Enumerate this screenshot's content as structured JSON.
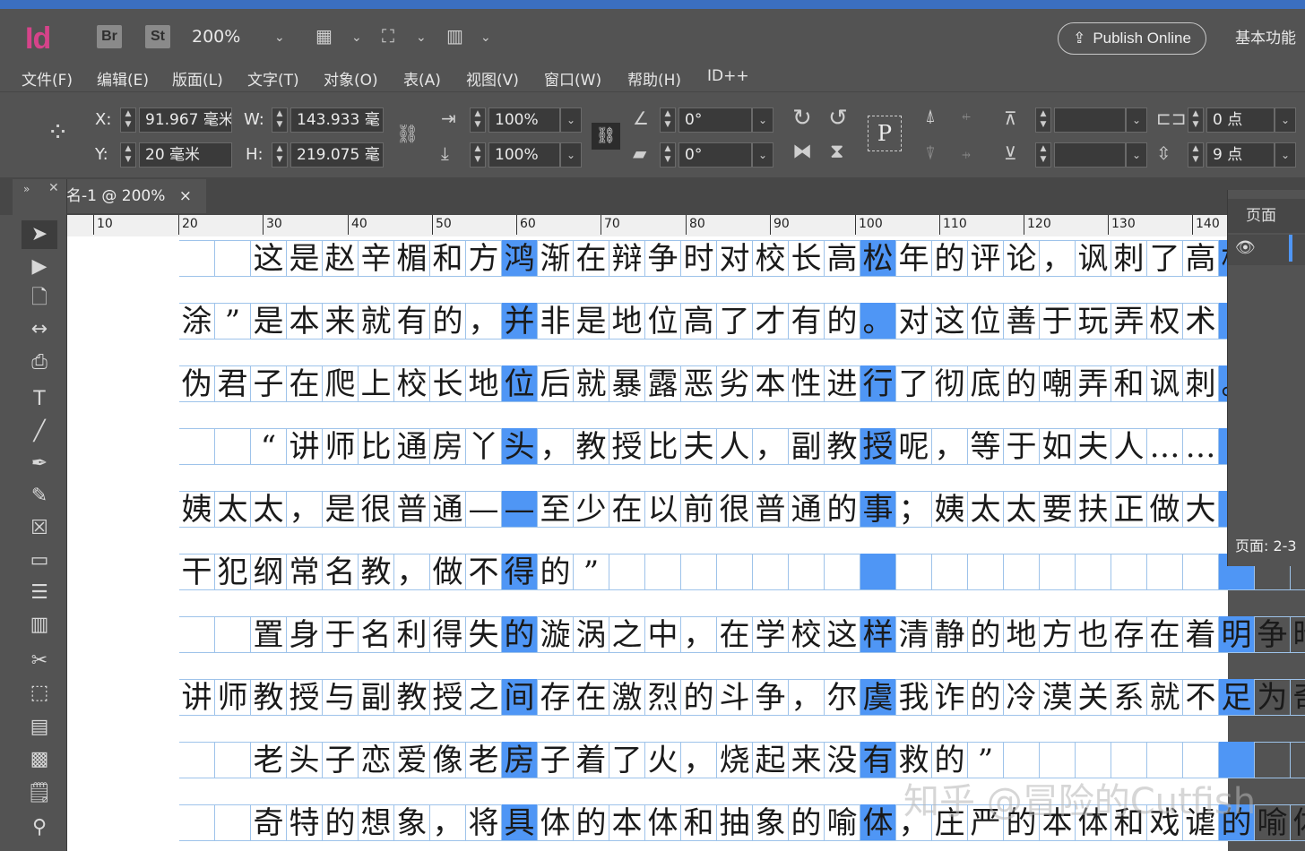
{
  "app": {
    "logo": "Id",
    "bridge_label": "Br",
    "stock_label": "St",
    "zoom": "200%",
    "publish_label": "Publish Online",
    "workspace": "基本功能"
  },
  "menu": [
    "文件(F)",
    "编辑(E)",
    "版面(L)",
    "文字(T)",
    "对象(O)",
    "表(A)",
    "视图(V)",
    "窗口(W)",
    "帮助(H)",
    "ID++"
  ],
  "control": {
    "x_label": "X:",
    "x_value": "91.967 毫米",
    "y_label": "Y:",
    "y_value": "20 毫米",
    "w_label": "W:",
    "w_value": "143.933 毫",
    "h_label": "H:",
    "h_value": "219.075 毫",
    "scale_x": "100%",
    "scale_y": "100%",
    "rotate": "0°",
    "shear": "0°",
    "spacing_value": "0 点",
    "leading_value": "9 点",
    "stroke_p": "P"
  },
  "document_tab": {
    "title": "名-1 @ 200%",
    "close": "×"
  },
  "ruler": [
    "10",
    "20",
    "30",
    "40",
    "50",
    "60",
    "70",
    "80",
    "90",
    "100",
    "110",
    "120",
    "130",
    "140"
  ],
  "pages_panel": {
    "title": "页面",
    "footer": "页面: 2-3"
  },
  "text_lines": [
    "  这是赵辛楣和方鸿渐在辩争时对校长高松年的评论，讽刺了高松",
    "涂”是本来就有的，并非是地位高了才有的。对这位善于玩弄权术",
    "伪君子在爬上校长地位后就暴露恶劣本性进行了彻底的嘲弄和讽刺。",
    "  “讲师比通房丫头，教授比夫人，副教授呢，等于如夫人……",
    "姨太太，是很普通——至少在以前很普通的事；姨太太要扶正做大",
    "干犯纲常名教，做不得的”",
    "  置身于名利得失的漩涡之中，在学校这样清静的地方也存在着明争暗",
    "讲师教授与副教授之间存在激烈的斗争，尔虞我诈的冷漠关系就不足为奇",
    "  老头子恋爱像老房子着了火，烧起来没有救的”",
    "  奇特的想象，将具体的本体和抽象的喻体，庄严的本体和戏谑的喻体"
  ],
  "watermark": "知乎 @冒险的Cutfish"
}
